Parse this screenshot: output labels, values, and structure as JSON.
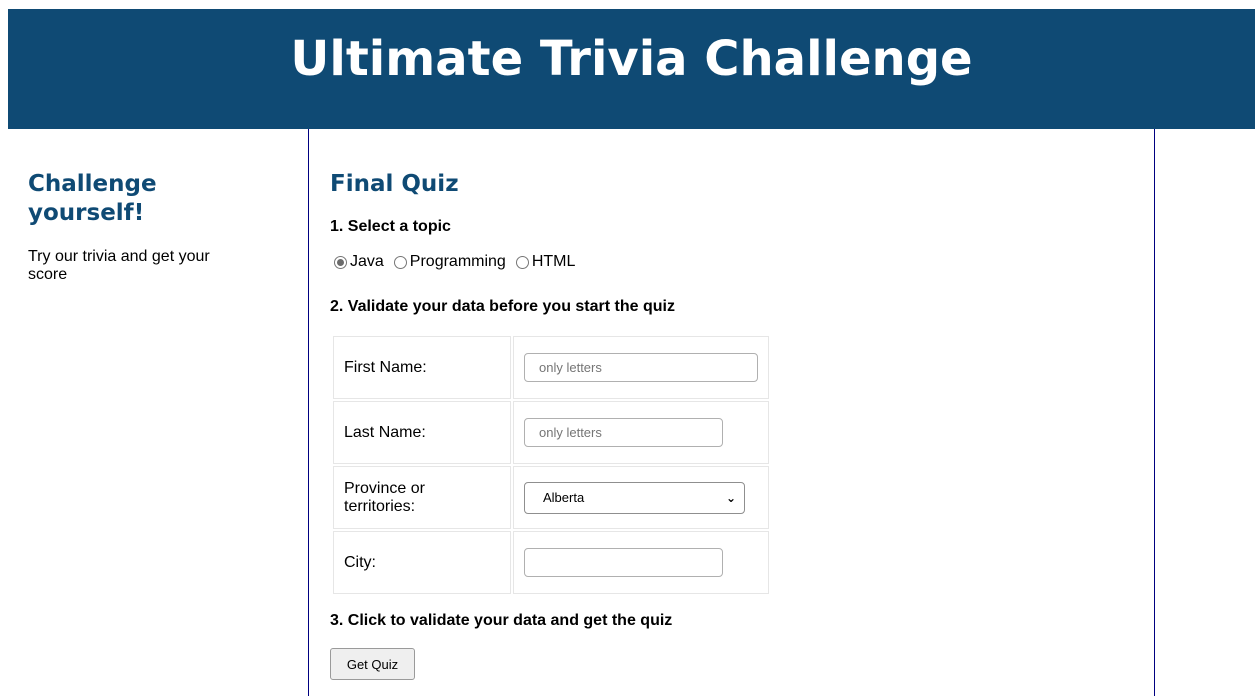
{
  "header": {
    "title": "Ultimate Trivia Challenge"
  },
  "sidebar": {
    "title": "Challenge yourself!",
    "text": "Try our trivia and get your score"
  },
  "main": {
    "title": "Final Quiz",
    "step1": "1. Select a topic",
    "topics": [
      {
        "label": "Java",
        "checked": true
      },
      {
        "label": "Programming",
        "checked": false
      },
      {
        "label": "HTML",
        "checked": false
      }
    ],
    "step2": "2. Validate your data before you start the quiz",
    "form": {
      "first_name_label": "First Name:",
      "first_name_placeholder": "only letters",
      "last_name_label": "Last Name:",
      "last_name_placeholder": "only letters",
      "province_label": "Province or territories:",
      "province_value": "Alberta",
      "city_label": "City:",
      "city_value": ""
    },
    "step3": "3. Click to validate your data and get the quiz",
    "button": "Get Quiz"
  },
  "colors": {
    "brand": "#0f4a74",
    "divider": "#000080"
  }
}
